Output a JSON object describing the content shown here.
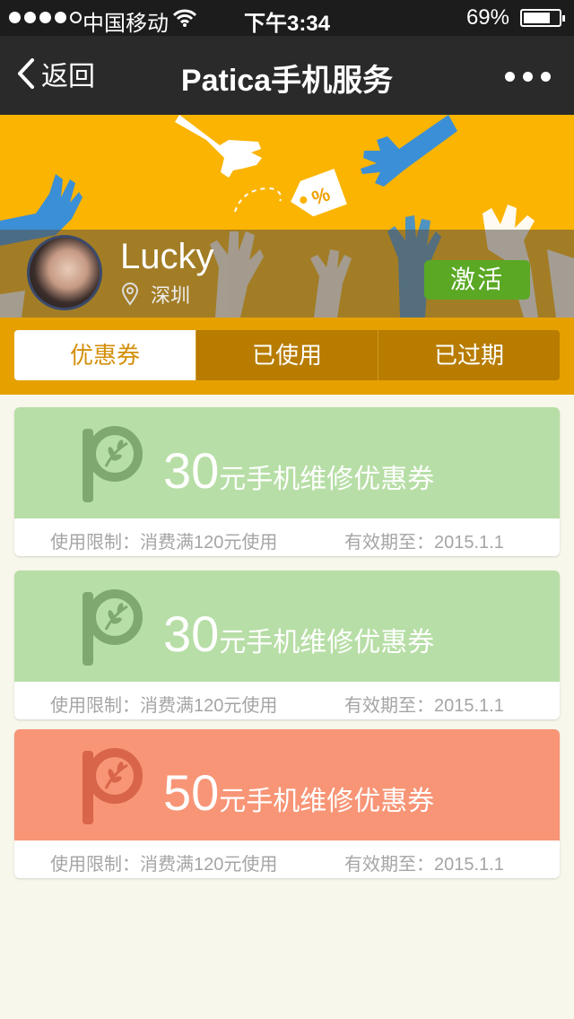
{
  "status_bar": {
    "carrier": "中国移动",
    "time": "下午3:34",
    "battery_percent": "69%",
    "battery_level": 0.69,
    "signal_bars": 4
  },
  "nav": {
    "back_label": "返回",
    "title": "Patica手机服务"
  },
  "profile": {
    "name": "Lucky",
    "location": "深圳",
    "activate_label": "激活"
  },
  "tabs": [
    {
      "label": "优惠券",
      "active": true
    },
    {
      "label": "已使用",
      "active": false
    },
    {
      "label": "已过期",
      "active": false
    }
  ],
  "coupons": [
    {
      "amount": "30",
      "description": "元手机维修优惠券",
      "limit": "使用限制：消费满120元使用",
      "expiry": "有效期至：2015.1.1",
      "color": "#b7dea6"
    },
    {
      "amount": "30",
      "description": "元手机维修优惠券",
      "limit": "使用限制：消费满120元使用",
      "expiry": "有效期至：2015.1.1",
      "color": "#b7dea6"
    },
    {
      "amount": "50",
      "description": "元手机维修优惠券",
      "limit": "使用限制：消费满120元使用",
      "expiry": "有效期至：2015.1.1",
      "color": "#f79576"
    }
  ],
  "colors": {
    "banner": "#fbb402",
    "tab_bar": "#e6a100",
    "activate_button": "#5aa824",
    "coupon_green": "#b7dea6",
    "coupon_orange": "#f79576"
  },
  "icons": [
    "wifi-icon",
    "battery-icon",
    "back-chevron-icon",
    "more-icon",
    "location-pin-icon",
    "patica-logo-icon"
  ]
}
